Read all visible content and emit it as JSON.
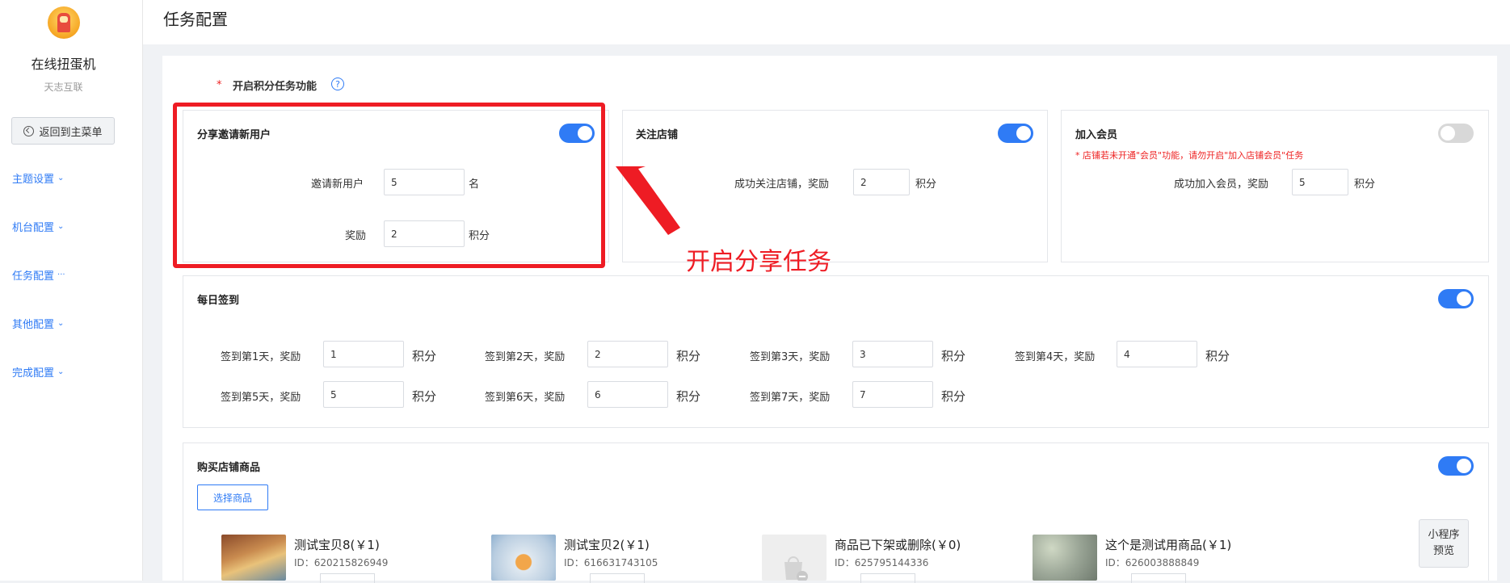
{
  "sidebar": {
    "app_name": "在线扭蛋机",
    "company": "天志互联",
    "back_label": "返回到主菜单",
    "items": [
      {
        "label": "主题设置",
        "marker": "⌄"
      },
      {
        "label": "机台配置",
        "marker": "⌄"
      },
      {
        "label": "任务配置",
        "marker": "···"
      },
      {
        "label": "其他配置",
        "marker": "⌄"
      },
      {
        "label": "完成配置",
        "marker": "⌄"
      }
    ]
  },
  "header": {
    "title": "任务配置"
  },
  "settings": {
    "required_mark": "*",
    "enable_label": "开启积分任务功能",
    "help_glyph": "?"
  },
  "share_card": {
    "title": "分享邀请新用户",
    "enabled": true,
    "invite_label": "邀请新用户",
    "invite_value": "5",
    "invite_unit": "名",
    "reward_label": "奖励",
    "reward_value": "2",
    "reward_unit": "积分"
  },
  "follow_card": {
    "title": "关注店铺",
    "enabled": true,
    "reward_label": "成功关注店铺，奖励",
    "reward_value": "2",
    "reward_unit": "积分"
  },
  "member_card": {
    "title": "加入会员",
    "enabled": false,
    "warning": "* 店铺若未开通\"会员\"功能，请勿开启\"加入店铺会员\"任务",
    "reward_label": "成功加入会员，奖励",
    "reward_value": "5",
    "reward_unit": "积分"
  },
  "daily_card": {
    "title": "每日签到",
    "enabled": true,
    "days": [
      {
        "label": "签到第1天，奖励",
        "value": "1",
        "unit": "积分"
      },
      {
        "label": "签到第2天，奖励",
        "value": "2",
        "unit": "积分"
      },
      {
        "label": "签到第3天，奖励",
        "value": "3",
        "unit": "积分"
      },
      {
        "label": "签到第4天，奖励",
        "value": "4",
        "unit": "积分"
      },
      {
        "label": "签到第5天，奖励",
        "value": "5",
        "unit": "积分"
      },
      {
        "label": "签到第6天，奖励",
        "value": "6",
        "unit": "积分"
      },
      {
        "label": "签到第7天，奖励",
        "value": "7",
        "unit": "积分"
      }
    ]
  },
  "purchase_card": {
    "title": "购买店铺商品",
    "enabled": true,
    "select_label": "选择商品",
    "preview_line1": "小程序",
    "preview_line2": "预览",
    "products": [
      {
        "name": "测试宝贝8(￥1)",
        "id": "ID：620215826949"
      },
      {
        "name": "测试宝贝2(￥1)",
        "id": "ID：616631743105"
      },
      {
        "name": "商品已下架或删除(￥0)",
        "id": "ID：625795144336"
      },
      {
        "name": "这个是测试用商品(￥1)",
        "id": "ID：626003888849"
      }
    ]
  },
  "annotation": {
    "text": "开启分享任务"
  },
  "colors": {
    "accent": "#2f7bf5",
    "annotation": "#ee1c24",
    "warning": "#e22222"
  }
}
